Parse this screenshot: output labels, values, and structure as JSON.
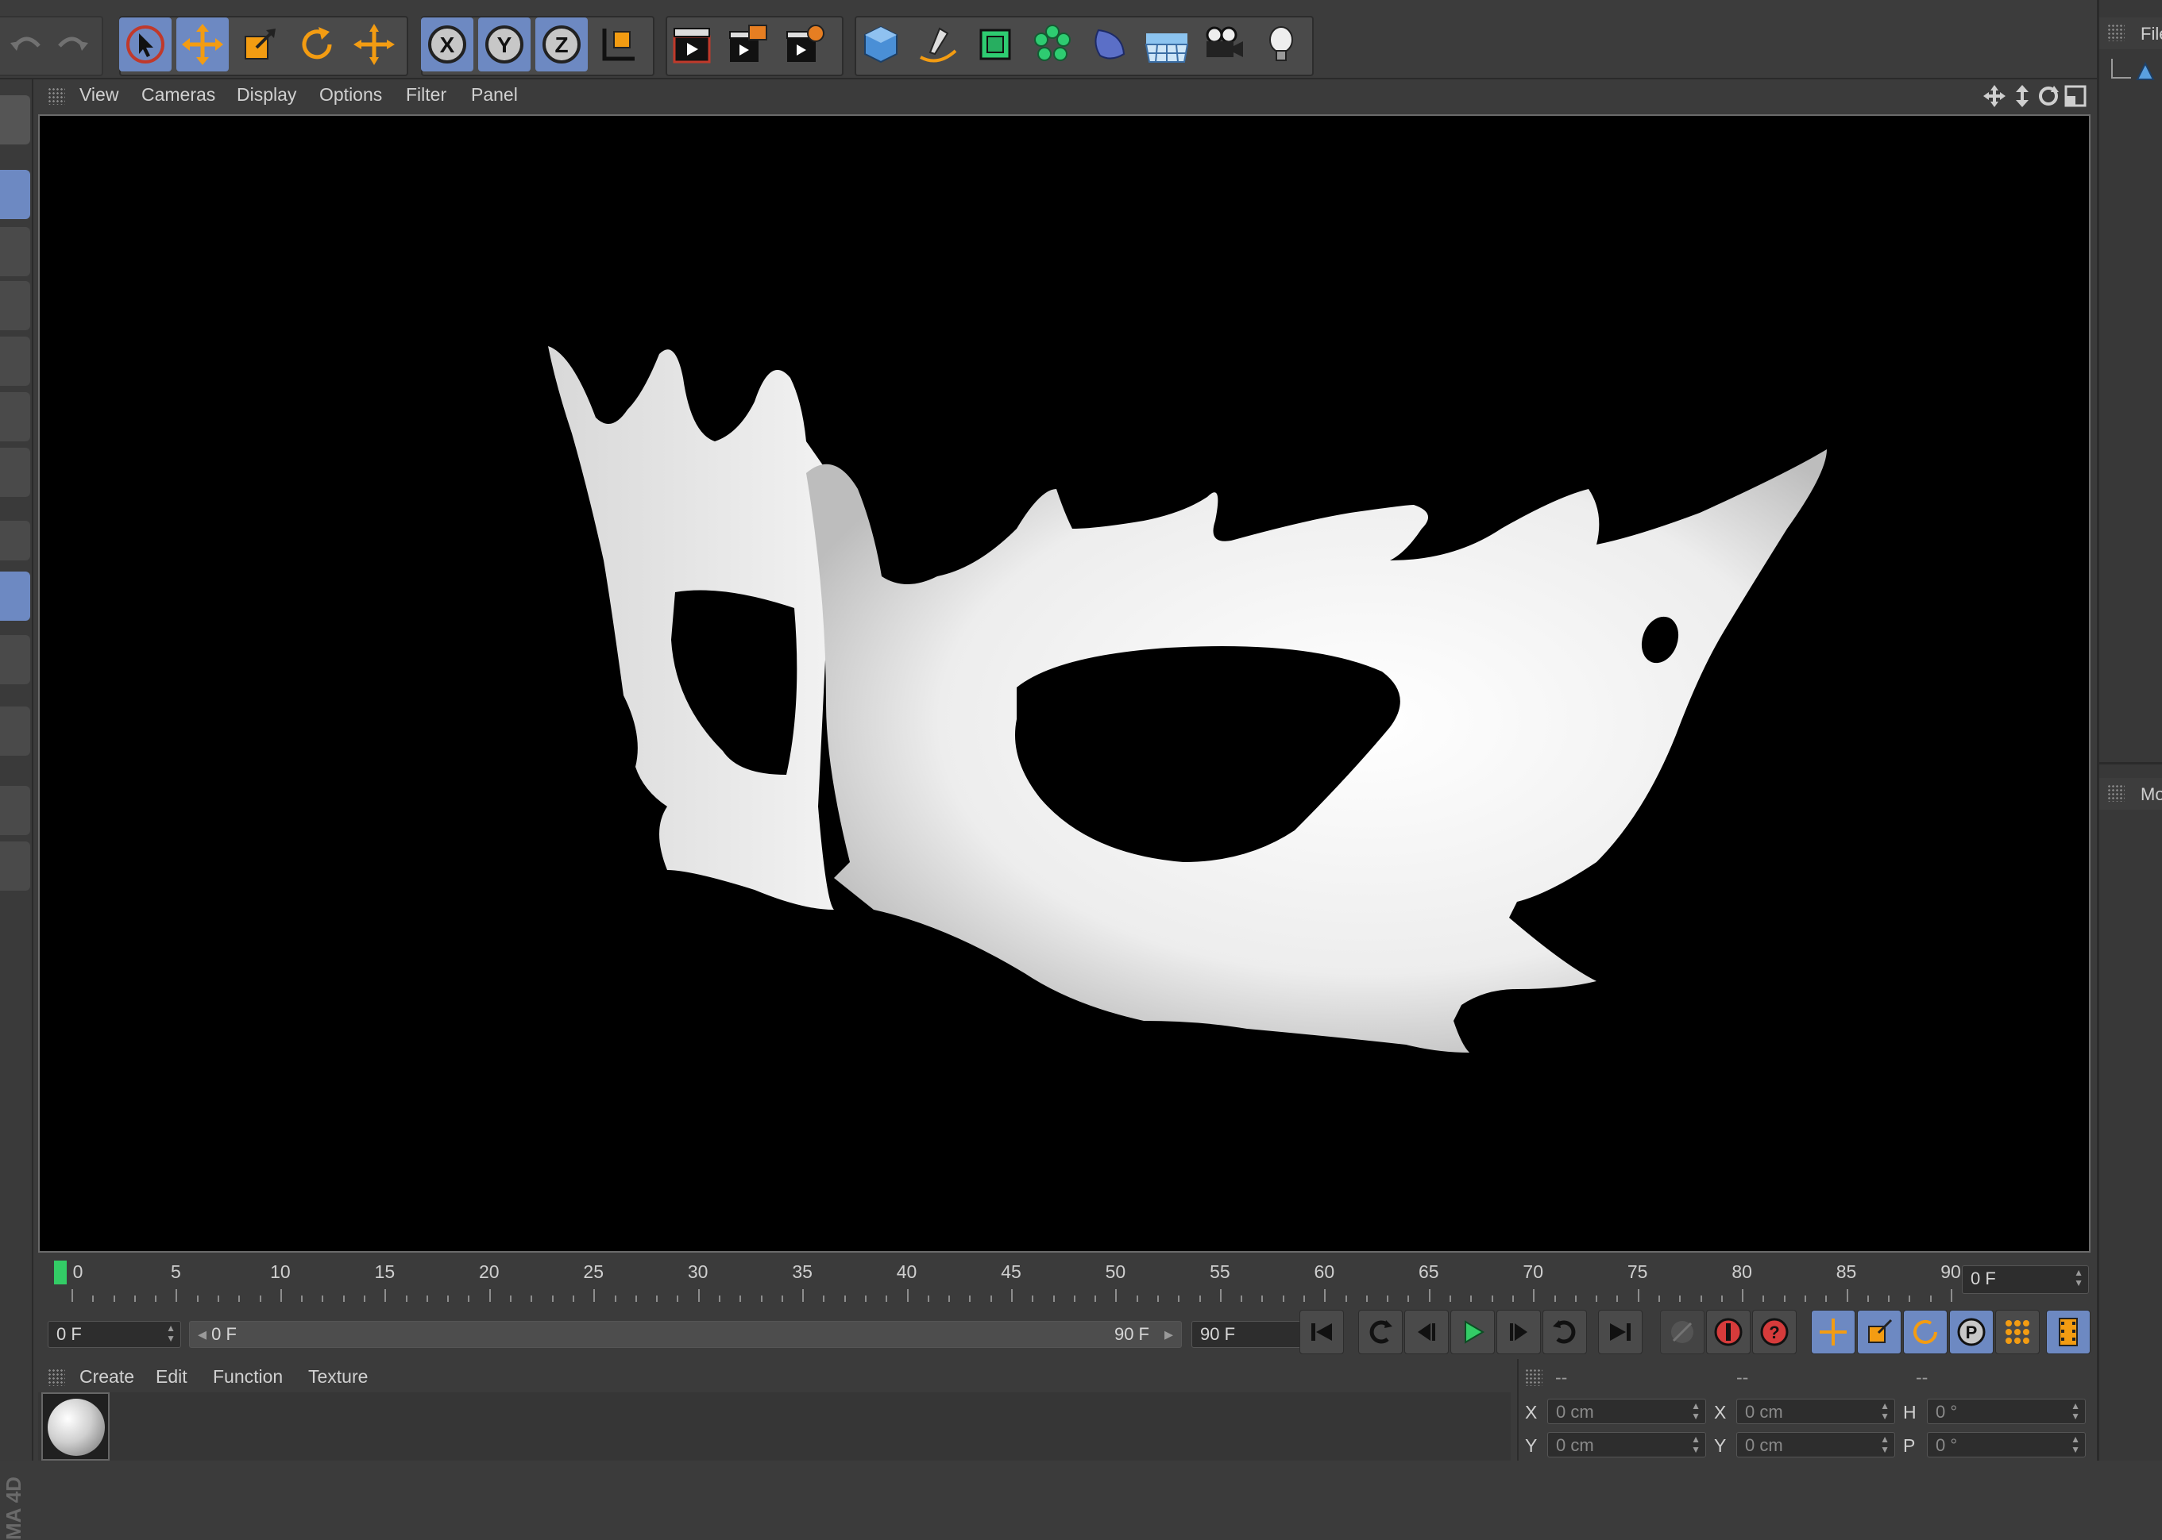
{
  "toolbar": {
    "buttons": [
      "undo-icon",
      "redo-icon",
      "select-arrow-icon",
      "move-icon",
      "scale-icon",
      "rotate-icon",
      "live-selection-icon",
      "x-axis-icon",
      "y-axis-icon",
      "z-axis-icon",
      "coordinate-system-icon",
      "render-view-icon",
      "render-picture-viewer-icon",
      "render-settings-icon",
      "cube-icon",
      "pen-spline-icon",
      "subdivision-icon",
      "cloner-icon",
      "deformer-icon",
      "floor-icon",
      "camera-icon",
      "light-bulb-icon"
    ],
    "axis_labels": {
      "x": "X",
      "y": "Y",
      "z": "Z"
    },
    "accent": "#6d89c2"
  },
  "viewport": {
    "menu": [
      "View",
      "Cameras",
      "Display",
      "Options",
      "Filter",
      "Panel"
    ],
    "background": "#000000",
    "model_color": "#ececec"
  },
  "right_panel": {
    "top_header": "File",
    "bottom_header": "Mo"
  },
  "left_vertical_label": "MA 4D",
  "timeline": {
    "ticks": [
      "0",
      "5",
      "10",
      "15",
      "20",
      "25",
      "30",
      "35",
      "40",
      "45",
      "50",
      "55",
      "60",
      "65",
      "70",
      "75",
      "80",
      "85",
      "90"
    ],
    "current_frame_field": "0 F",
    "start_field": "0 F",
    "range_start": "0 F",
    "range_end": "90 F",
    "end_field": "90 F",
    "playhead_color": "#33cc66"
  },
  "transport": {
    "buttons": [
      "go-to-start-icon",
      "previous-key-icon",
      "previous-frame-icon",
      "play-icon",
      "next-frame-icon",
      "next-key-icon",
      "go-to-end-icon",
      "keyframe-off-icon",
      "record-icon",
      "autokey-icon",
      "key-position-icon",
      "key-scale-icon",
      "key-rotation-icon",
      "key-parameter-icon",
      "key-pla-icon",
      "timeline-icon"
    ]
  },
  "material_manager": {
    "menu": [
      "Create",
      "Edit",
      "Function",
      "Texture"
    ]
  },
  "coordinates": {
    "headers": [
      "--",
      "--",
      "--"
    ],
    "row1": {
      "pos_label": "X",
      "pos_value": "0 cm",
      "size_label": "X",
      "size_value": "0 cm",
      "rot_label": "H",
      "rot_value": "0 °"
    },
    "row2": {
      "pos_label": "Y",
      "pos_value": "0 cm",
      "size_label": "Y",
      "size_value": "0 cm",
      "rot_label": "P",
      "rot_value": "0 °"
    }
  }
}
